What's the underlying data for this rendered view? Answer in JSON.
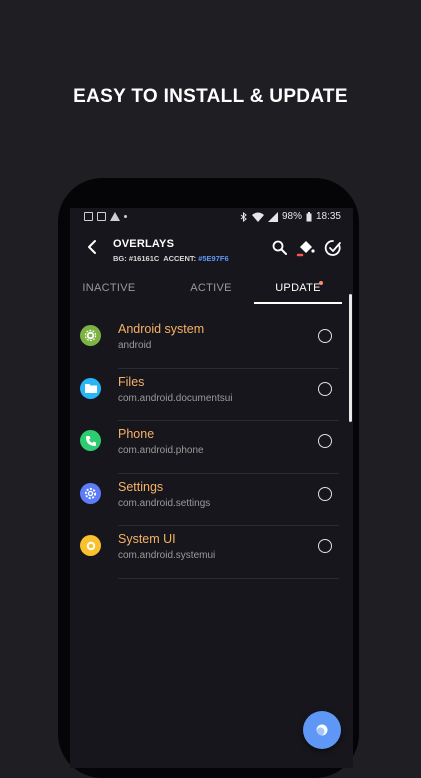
{
  "headline": "EASY TO INSTALL & UPDATE",
  "status_bar": {
    "battery": "98%",
    "time": "18:35",
    "icons": [
      "image-icon",
      "image-icon",
      "drive-icon",
      "dot-icon",
      "bluetooth-icon",
      "wifi-icon",
      "signal-icon",
      "battery-icon"
    ]
  },
  "toolbar": {
    "title": "OVERLAYS",
    "bg_label": "BG:",
    "bg_value": "#16161C",
    "accent_label": "ACCENT:",
    "accent_value": "#5E97F6",
    "icons": [
      "back-arrow-icon",
      "search-icon",
      "paint-bucket-icon",
      "select-all-icon"
    ]
  },
  "tabs": [
    {
      "label": "INACTIVE",
      "selected": false
    },
    {
      "label": "ACTIVE",
      "selected": false
    },
    {
      "label": "UPDATE",
      "selected": true,
      "has_notification_dot": true
    }
  ],
  "apps": [
    {
      "name": "Android system",
      "package": "android",
      "icon": "android-system-icon",
      "icon_color": "#7cb342"
    },
    {
      "name": "Files",
      "package": "com.android.documentsui",
      "icon": "folder-icon",
      "icon_color": "#29b6f6"
    },
    {
      "name": "Phone",
      "package": "com.android.phone",
      "icon": "phone-icon",
      "icon_color": "#2ecc71"
    },
    {
      "name": "Settings",
      "package": "com.android.settings",
      "icon": "gear-icon",
      "icon_color": "#5c7cfa"
    },
    {
      "name": "System UI",
      "package": "com.android.systemui",
      "icon": "system-ui-icon",
      "icon_color": "#fbc02d"
    }
  ],
  "fab": {
    "icon": "overlay-apply-icon",
    "color": "#5E97F6"
  },
  "colors": {
    "background": "#16161C",
    "accent": "#5E97F6",
    "app_name": "#F7B267"
  }
}
